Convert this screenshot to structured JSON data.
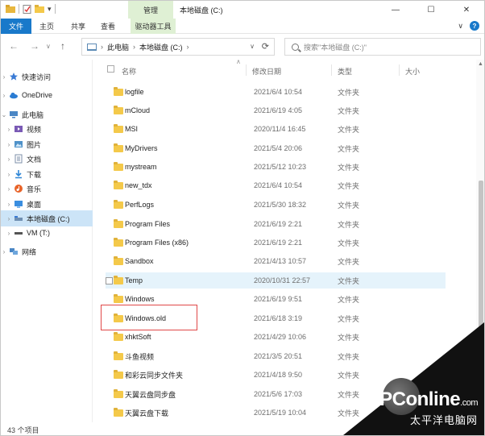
{
  "titlebar": {
    "manage_tab": "管理",
    "title": "本地磁盘 (C:)",
    "minimize": "—",
    "maximize": "☐",
    "close": "✕"
  },
  "ribbon": {
    "file": "文件",
    "home": "主页",
    "share": "共享",
    "view": "查看",
    "drive_tools": "驱动器工具",
    "expand": "∨",
    "help": "?"
  },
  "nav": {
    "back": "←",
    "forward": "→",
    "dropdown": "∨",
    "up": "↑",
    "address": {
      "crumbs": [
        "此电脑",
        "本地磁盘 (C:)"
      ],
      "separator": "›",
      "dropdown": "∨",
      "refresh": "⟳"
    },
    "search_placeholder": "搜索\"本地磁盘 (C:)\""
  },
  "navpane": {
    "items": [
      {
        "label": "快速访问",
        "icon": "star-icon",
        "color": "#3a7bd5"
      },
      {
        "label": "OneDrive",
        "icon": "cloud-icon",
        "color": "#2b7cd3"
      },
      {
        "label": "此电脑",
        "icon": "computer-icon",
        "color": "#4a86c5"
      },
      {
        "label": "视频",
        "icon": "video-icon",
        "color": "#7a5ab5"
      },
      {
        "label": "图片",
        "icon": "pictures-icon",
        "color": "#4f92c9"
      },
      {
        "label": "文档",
        "icon": "documents-icon",
        "color": "#7c8fa8"
      },
      {
        "label": "下载",
        "icon": "download-icon",
        "color": "#2f86d6"
      },
      {
        "label": "音乐",
        "icon": "music-icon",
        "color": "#e8642a"
      },
      {
        "label": "桌面",
        "icon": "desktop-icon",
        "color": "#3a8ee0"
      },
      {
        "label": "本地磁盘 (C:)",
        "icon": "drive-icon",
        "color": "#6f8fb2"
      },
      {
        "label": "VM (T:)",
        "icon": "drive-icon",
        "color": "#555555"
      },
      {
        "label": "网络",
        "icon": "network-icon",
        "color": "#4a86c5"
      }
    ]
  },
  "columns": {
    "name": "名称",
    "date": "修改日期",
    "type": "类型",
    "size": "大小",
    "sort_indicator": "∧"
  },
  "files": [
    {
      "name": "logfile",
      "date": "2021/6/4 10:54",
      "type": "文件夹"
    },
    {
      "name": "mCloud",
      "date": "2021/6/19 4:05",
      "type": "文件夹"
    },
    {
      "name": "MSI",
      "date": "2020/11/4 16:45",
      "type": "文件夹"
    },
    {
      "name": "MyDrivers",
      "date": "2021/5/4 20:06",
      "type": "文件夹"
    },
    {
      "name": "mystream",
      "date": "2021/5/12 10:23",
      "type": "文件夹"
    },
    {
      "name": "new_tdx",
      "date": "2021/6/4 10:54",
      "type": "文件夹"
    },
    {
      "name": "PerfLogs",
      "date": "2021/5/30 18:32",
      "type": "文件夹"
    },
    {
      "name": "Program Files",
      "date": "2021/6/19 2:21",
      "type": "文件夹"
    },
    {
      "name": "Program Files (x86)",
      "date": "2021/6/19 2:21",
      "type": "文件夹"
    },
    {
      "name": "Sandbox",
      "date": "2021/4/13 10:57",
      "type": "文件夹"
    },
    {
      "name": "Temp",
      "date": "2020/10/31 22:57",
      "type": "文件夹"
    },
    {
      "name": "Windows",
      "date": "2021/6/19 9:51",
      "type": "文件夹"
    },
    {
      "name": "Windows.old",
      "date": "2021/6/18 3:19",
      "type": "文件夹"
    },
    {
      "name": "xhktSoft",
      "date": "2021/4/29 10:06",
      "type": "文件夹"
    },
    {
      "name": "斗鱼视频",
      "date": "2021/3/5 20:51",
      "type": "文件夹"
    },
    {
      "name": "和彩云同步文件夹",
      "date": "2021/4/18 9:50",
      "type": "文件夹"
    },
    {
      "name": "天翼云盘同步盘",
      "date": "2021/5/6 17:03",
      "type": "文件夹"
    },
    {
      "name": "天翼云盘下载",
      "date": "2021/5/19 10:04",
      "type": "文件夹"
    }
  ],
  "status": {
    "count": "43 个项目"
  },
  "watermark": {
    "logo": "PConline",
    "suffix": ".com",
    "sub": "太平洋电脑网"
  }
}
